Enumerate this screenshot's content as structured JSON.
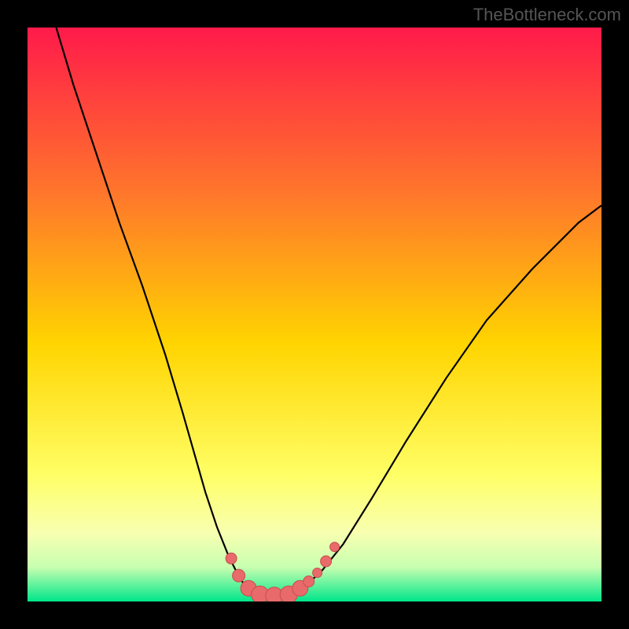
{
  "watermark": "TheBottleneck.com",
  "colors": {
    "frame": "#000000",
    "gradient_top": "#ff1a4a",
    "gradient_mid1": "#ff7a2a",
    "gradient_mid2": "#ffd400",
    "gradient_mid3": "#ffff66",
    "gradient_mid4": "#f8ffb0",
    "gradient_mid5": "#c8ffb0",
    "gradient_bottom": "#00e68a",
    "curve": "#000000",
    "marker_fill": "#e86a6a",
    "marker_stroke": "#c94d4d"
  },
  "chart_data": {
    "type": "line",
    "title": "",
    "xlabel": "",
    "ylabel": "",
    "xlim": [
      0,
      100
    ],
    "ylim": [
      0,
      100
    ],
    "series": [
      {
        "name": "bottleneck-curve",
        "x": [
          5,
          8,
          12,
          16,
          20,
          24,
          27,
          29,
          31,
          33,
          35,
          36.5,
          38,
          40,
          42,
          44,
          46,
          48,
          51,
          55,
          60,
          66,
          73,
          80,
          88,
          96,
          100
        ],
        "y": [
          100,
          90,
          78,
          66,
          55,
          43,
          33,
          26,
          19,
          13,
          8,
          5,
          2.5,
          1.2,
          1,
          1,
          1.2,
          2.5,
          5,
          10,
          18,
          28,
          39,
          49,
          58,
          66,
          69
        ]
      }
    ],
    "markers": {
      "name": "highlight-points",
      "points": [
        {
          "x": 35.5,
          "y": 7.5,
          "r": 7
        },
        {
          "x": 36.8,
          "y": 4.5,
          "r": 8
        },
        {
          "x": 38.5,
          "y": 2.3,
          "r": 10
        },
        {
          "x": 40.5,
          "y": 1.2,
          "r": 11
        },
        {
          "x": 43.0,
          "y": 1.0,
          "r": 11
        },
        {
          "x": 45.5,
          "y": 1.2,
          "r": 11
        },
        {
          "x": 47.5,
          "y": 2.3,
          "r": 10
        },
        {
          "x": 49.0,
          "y": 3.5,
          "r": 7
        },
        {
          "x": 50.5,
          "y": 5.0,
          "r": 6
        },
        {
          "x": 52.0,
          "y": 7.0,
          "r": 7
        },
        {
          "x": 53.5,
          "y": 9.5,
          "r": 6
        }
      ]
    }
  }
}
